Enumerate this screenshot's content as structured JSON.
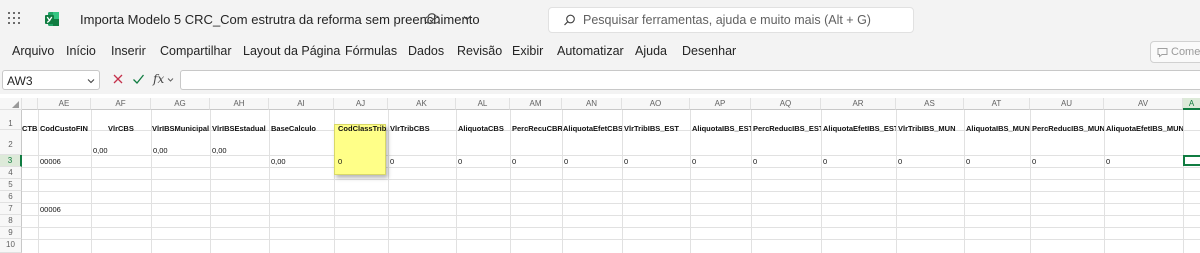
{
  "titlebar": {
    "title": "Importa Modelo 5 CRC_Com estrutra da reforma  sem preenchimento",
    "search_placeholder": "Pesquisar ferramentas, ajuda e muito mais (Alt + G)",
    "icons": [
      "app-launcher-icon",
      "excel-logo-icon",
      "cloud-saved-icon",
      "chevron-down-icon",
      "search-icon"
    ]
  },
  "ribbon": {
    "tabs": [
      "Arquivo",
      "Início",
      "Inserir",
      "Compartilhar",
      "Layout da Página",
      "Fórmulas",
      "Dados",
      "Revisão",
      "Exibir",
      "Automatizar",
      "Ajuda",
      "Desenhar"
    ],
    "comments_label": "Comer"
  },
  "formula_bar": {
    "name_box": "AW3",
    "fx_label": "fx",
    "formula": ""
  },
  "grid": {
    "columns": [
      "AE",
      "AF",
      "AG",
      "AH",
      "AI",
      "AJ",
      "AK",
      "AL",
      "AM",
      "AN",
      "AO",
      "AP",
      "AQ",
      "AR",
      "AS",
      "AT",
      "AU",
      "AV",
      "A"
    ],
    "rows": [
      "1",
      "2",
      "3",
      "4",
      "5",
      "6",
      "7",
      "8",
      "9",
      "10"
    ],
    "header_row": [
      "CodCustoFIN",
      "VlrCBS",
      "VlrIBSMunicipal",
      "VlrIBSEstadual",
      "BaseCalculo",
      "CodClassTrib",
      "VlrTribCBS",
      "AliquotaCBS",
      "PercRecuCBR",
      "AliquotaEfetCBS",
      "VlrTribIBS_EST",
      "AliquotaIBS_EST",
      "PercReducIBS_EST",
      "AliquotaEfetIBS_EST",
      "VlrTribIBS_MUN",
      "AliquotaIBS_MUN",
      "PercReducIBS_MUN",
      "AliquotaEfetIBS_MUN"
    ],
    "left_cut_header": "CTB",
    "row2_values": [
      "0,00",
      "0,00",
      "0,00"
    ],
    "row3_values": [
      "00006",
      "0,00",
      "0",
      "0",
      "0",
      "0",
      "0",
      "0",
      "0",
      "0",
      "0",
      "0",
      "0",
      "0",
      "0"
    ],
    "row7_values": [
      "00006"
    ]
  }
}
